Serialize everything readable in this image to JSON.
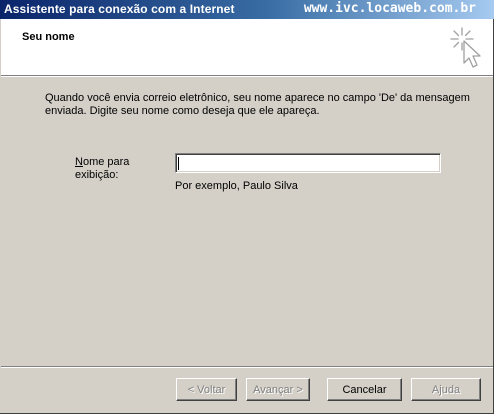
{
  "window": {
    "title": "Assistente para conexão com a Internet",
    "overlay_url": "www.ivc.locaweb.com.br"
  },
  "header": {
    "page_title": "Seu nome",
    "icon": "wizard-cursor-sparkle-icon"
  },
  "body": {
    "description": "Quando você envia correio eletrônico, seu nome aparece no campo 'De' da mensagem enviada. Digite seu nome como deseja que ele apareça.",
    "field_label_accel": "N",
    "field_label_rest": "ome para",
    "field_label_line2": "exibição:",
    "display_name_value": "",
    "example": "Por exemplo, Paulo Silva"
  },
  "buttons": {
    "back": "< Voltar",
    "next": "Avançar >",
    "cancel": "Cancelar",
    "help": "Ajuda"
  }
}
